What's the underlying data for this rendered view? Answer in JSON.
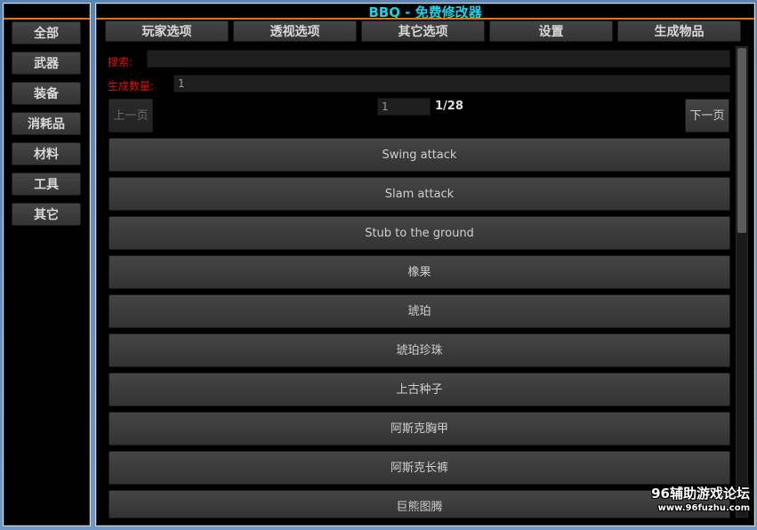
{
  "app": {
    "title": "BBQ - 免费修改器"
  },
  "categories": [
    "全部",
    "武器",
    "装备",
    "消耗品",
    "材料",
    "工具",
    "其它"
  ],
  "tabs": [
    "玩家选项",
    "透视选项",
    "其它选项",
    "设置",
    "生成物品"
  ],
  "search": {
    "label": "搜索:",
    "value": ""
  },
  "spawn_count": {
    "label": "生成数量:",
    "value": "1"
  },
  "pager": {
    "prev_label": "上一页",
    "next_label": "下一页",
    "page_input": "1",
    "page_total": "1/28"
  },
  "items": [
    "Swing attack",
    "Slam attack",
    "Stub to the ground",
    "橡果",
    "琥珀",
    "琥珀珍珠",
    "上古种子",
    "阿斯克胸甲",
    "阿斯克长裤",
    "巨熊图腾"
  ],
  "watermark": {
    "title": "96辅助游戏论坛",
    "url": "www.96fuzhu.com"
  },
  "colors": {
    "title": "#19d3e8",
    "accent_line": "#e1721e",
    "label": "#e01010"
  }
}
